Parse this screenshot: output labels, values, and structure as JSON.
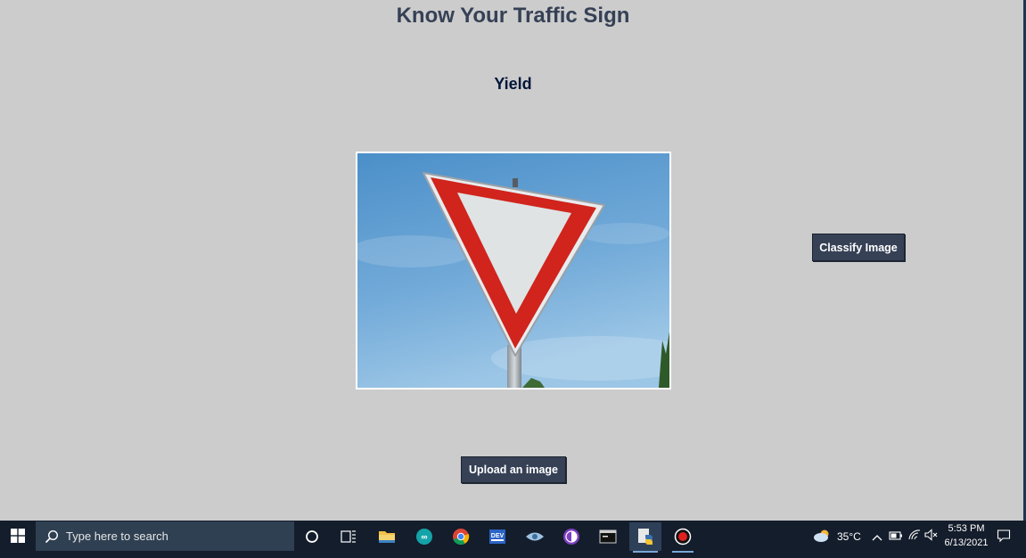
{
  "app": {
    "title": "Know Your Traffic Sign",
    "result_label": "Yield",
    "classify_button": "Classify Image",
    "upload_button": "Upload an image",
    "image_icon": "yield-sign-photo"
  },
  "taskbar": {
    "search_placeholder": "Type here to search",
    "pinned": [
      "cortana-icon",
      "task-view-icon",
      "file-explorer-icon",
      "arduino-icon",
      "chrome-icon",
      "dev-icon",
      "app-eye-icon",
      "tor-browser-icon",
      "terminal-icon",
      "python-icon",
      "screen-recorder-icon"
    ],
    "weather": {
      "temperature": "35°C",
      "icon": "partly-cloudy-icon"
    },
    "clock": {
      "time": "5:53 PM",
      "date": "6/13/2021"
    }
  },
  "colors": {
    "background": "#cccccc",
    "accent": "#364156",
    "title": "#364156",
    "result": "#011638",
    "taskbar": "#141d2b"
  }
}
